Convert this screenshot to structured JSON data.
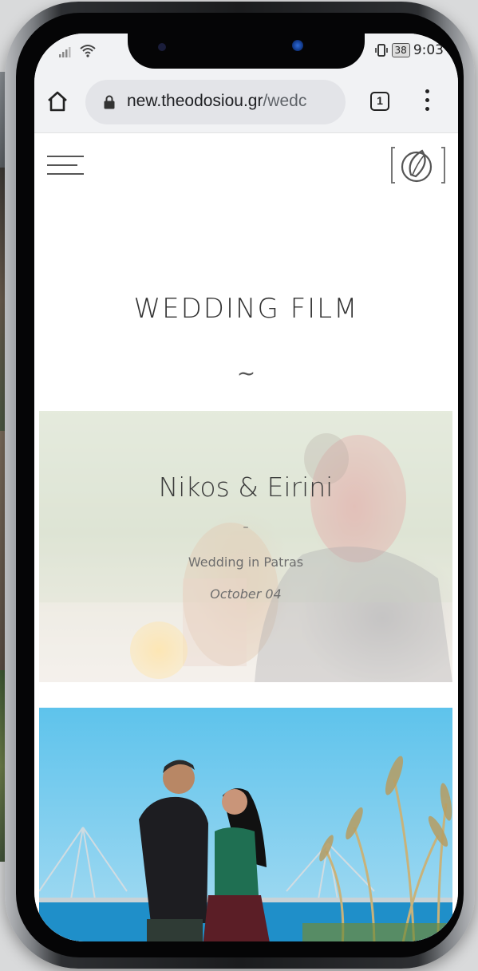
{
  "status_bar": {
    "time": "9:03",
    "battery": "38",
    "signal_icon": "signal-bars-icon",
    "wifi_icon": "wifi-icon",
    "vibrate_icon": "vibrate-icon"
  },
  "browser": {
    "url_host": "new.theodosiou.gr",
    "url_path": "/wedc",
    "tab_count": "1",
    "home_icon": "home-icon",
    "lock_icon": "lock-icon",
    "menu_icon": "more-vert-icon"
  },
  "site": {
    "menu_icon": "hamburger-menu-icon",
    "logo_icon": "leaf-logo-icon",
    "page_title": "WEDDING FILM",
    "divider": "~",
    "cards": [
      {
        "title": "Nikos & Eirini",
        "dash": "–",
        "subtitle": "Wedding in Patras",
        "date": "October 04"
      }
    ]
  },
  "colors": {
    "browser_chrome": "#f1f2f4",
    "url_pill": "#e3e4e8",
    "title_text": "#333333",
    "sky": "#5ec3ec",
    "sea": "#1f8fc9"
  }
}
